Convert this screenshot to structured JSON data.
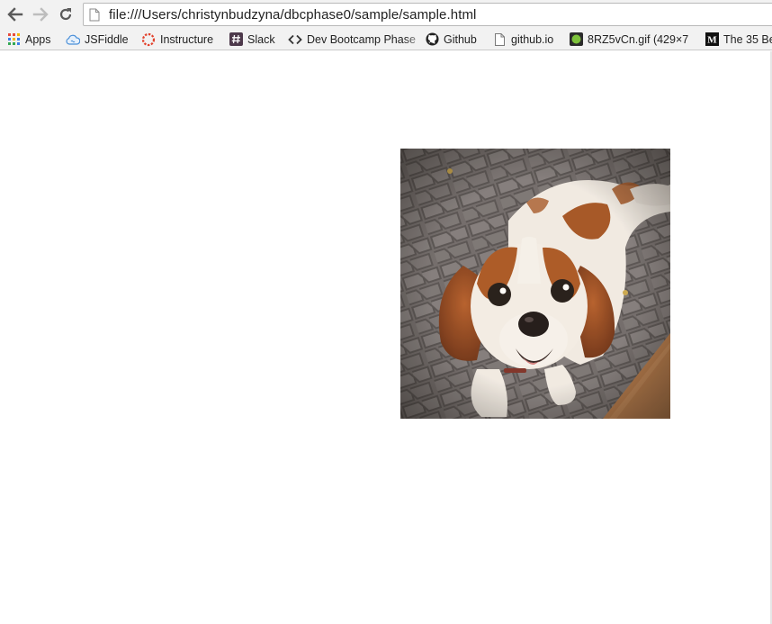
{
  "browser": {
    "url": "file:///Users/christynbudzyna/dbcphase0/sample/sample.html",
    "nav": {
      "back_icon": "arrow-left-icon",
      "forward_icon": "arrow-right-icon",
      "reload_icon": "reload-icon"
    },
    "bookmarks": [
      {
        "label": "Apps",
        "icon": "apps-grid-icon"
      },
      {
        "label": "JSFiddle",
        "icon": "jsfiddle-cloud-icon"
      },
      {
        "label": "Instructure",
        "icon": "instructure-icon"
      },
      {
        "label": "Slack",
        "icon": "slack-hash-icon"
      },
      {
        "label": "Dev Bootcamp Phase",
        "icon": "code-brackets-icon"
      },
      {
        "label": "Github",
        "icon": "github-octocat-icon"
      },
      {
        "label": "github.io",
        "icon": "page-icon"
      },
      {
        "label": "8RZ5vCn.gif (429×7",
        "icon": "gif-thumbnail-icon"
      },
      {
        "label": "The 35 Be",
        "icon": "medium-m-icon"
      }
    ]
  },
  "page": {
    "image": {
      "subject": "dog-photo",
      "colors": {
        "fur_brown": "#9a4a1e",
        "fur_white": "#f3efea",
        "pavement": "#6e6a6c",
        "wood": "#b87b4b"
      }
    }
  }
}
